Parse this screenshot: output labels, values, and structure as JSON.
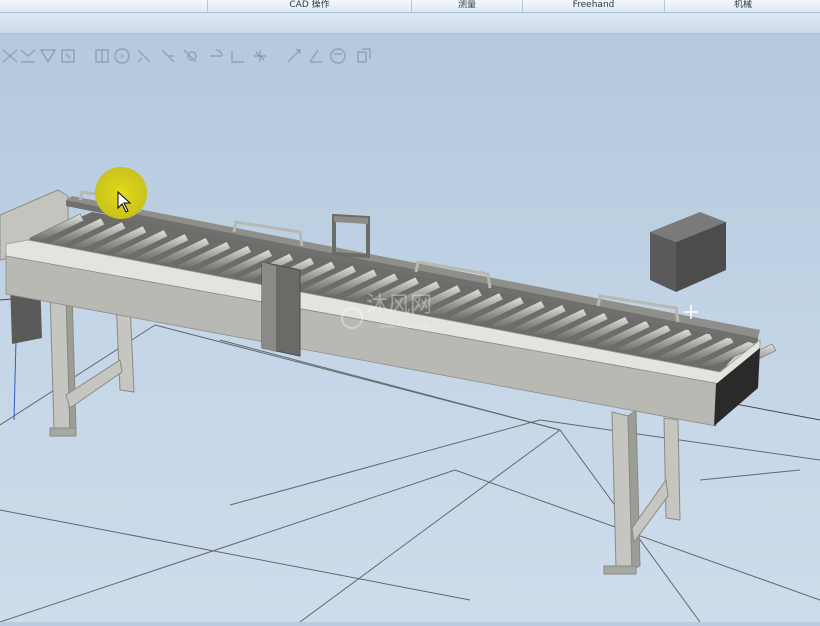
{
  "ribbon": {
    "tabs": [
      {
        "label": ""
      },
      {
        "label": "CAD 操作"
      },
      {
        "label": "测量"
      },
      {
        "label": "Freehand"
      },
      {
        "label": "机械"
      }
    ]
  },
  "toolbar": {
    "icons": [
      "snap-grid-icon",
      "snap-edge-icon",
      "snap-vertex-icon",
      "snap-center-icon",
      "snap-object-icon",
      "snap-circle-icon",
      "measure-line-icon",
      "measure-angle-icon",
      "measure-point-icon",
      "measure-radius-icon",
      "measure-length-icon",
      "measure-target-icon",
      "jog-icon",
      "angle-icon",
      "rotate-icon",
      "copy-icon"
    ]
  },
  "scene": {
    "object": "roller-conveyor",
    "box_color": "#555555",
    "floor_color": "#c8d8e8",
    "cursor_highlight_color": "#d6cf1f"
  }
}
